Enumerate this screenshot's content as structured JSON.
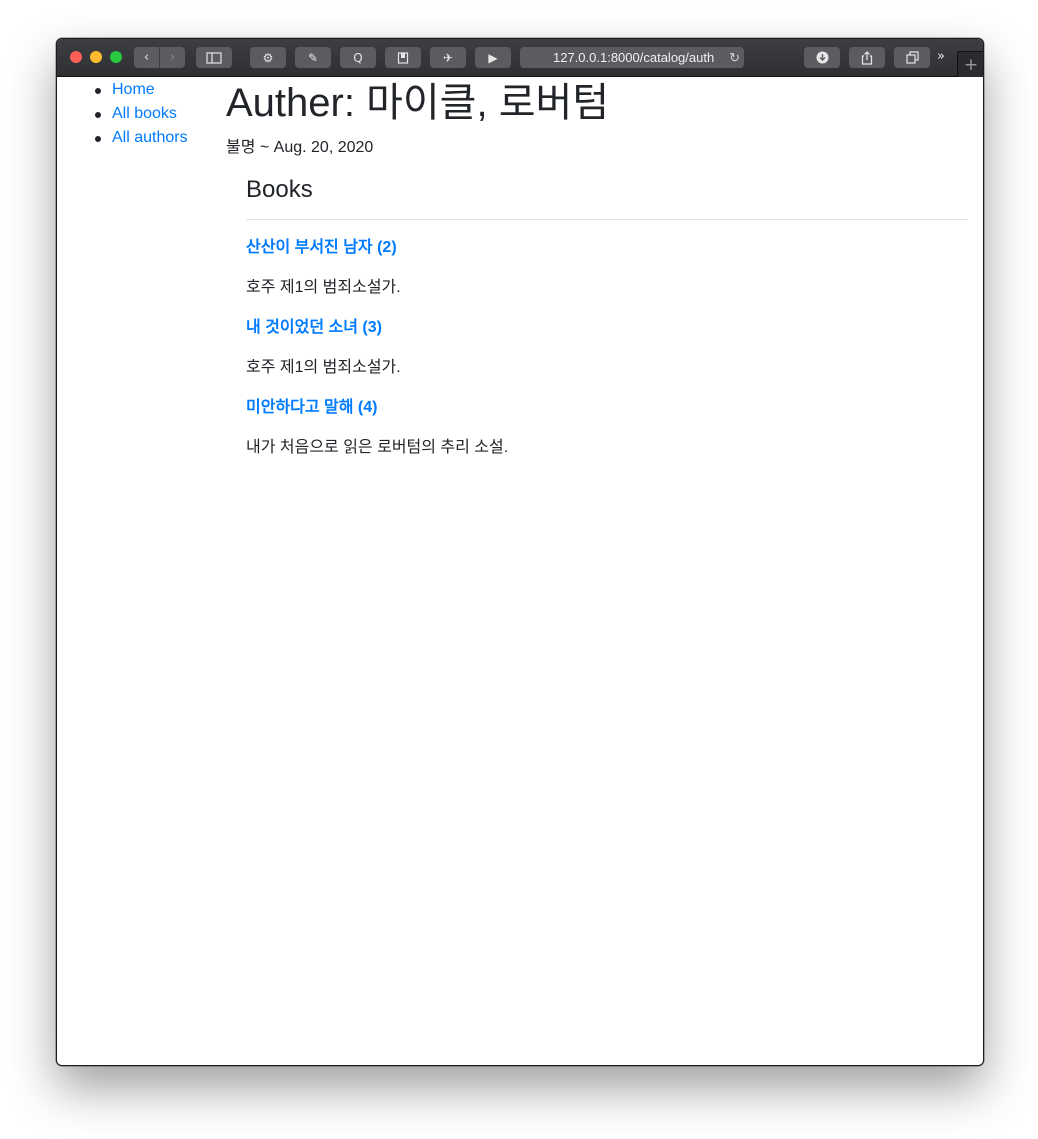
{
  "browser": {
    "address": "127.0.0.1:8000/catalog/auth",
    "icons": [
      "back-icon",
      "forward-icon",
      "sidebar-icon",
      "extension-icon",
      "extension-icon",
      "quote-icon",
      "bookmark-icon",
      "rocket-icon",
      "media-icon",
      "reload-icon",
      "download-icon",
      "share-icon",
      "tabs-icon",
      "more-icon",
      "new-tab-icon"
    ]
  },
  "sidenav": {
    "items": [
      {
        "label": "Home"
      },
      {
        "label": "All books"
      },
      {
        "label": "All authors"
      }
    ]
  },
  "author": {
    "title": "Auther: 마이클, 로버텀",
    "dates": "불명 ~ Aug. 20, 2020"
  },
  "books": {
    "heading": "Books",
    "items": [
      {
        "title": "산산이 부서진 남자 (2)",
        "summary": "호주 제1의 범죄소설가."
      },
      {
        "title": "내 것이었던 소녀 (3)",
        "summary": "호주 제1의 범죄소설가."
      },
      {
        "title": "미안하다고 말해 (4)",
        "summary": "내가 처음으로 읽은 로버텀의 추리 소설."
      }
    ]
  },
  "colors": {
    "link": "#007bff",
    "text": "#212529",
    "toolbar": "#3a3b3e"
  }
}
